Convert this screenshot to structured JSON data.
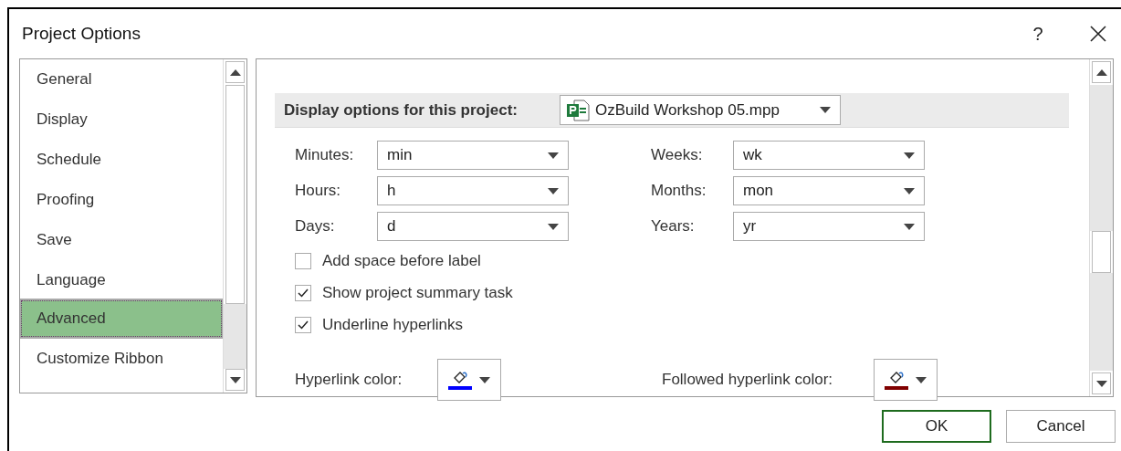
{
  "window": {
    "title": "Project Options",
    "help": "?"
  },
  "sidebar": {
    "items": [
      {
        "label": "General",
        "selected": false
      },
      {
        "label": "Display",
        "selected": false
      },
      {
        "label": "Schedule",
        "selected": false
      },
      {
        "label": "Proofing",
        "selected": false
      },
      {
        "label": "Save",
        "selected": false
      },
      {
        "label": "Language",
        "selected": false
      },
      {
        "label": "Advanced",
        "selected": true
      },
      {
        "label": "Customize Ribbon",
        "selected": false
      }
    ]
  },
  "section": {
    "title": "Display options for this project:",
    "project": "OzBuild Workshop 05.mpp"
  },
  "units_left": [
    {
      "label": "Minutes:",
      "value": "min"
    },
    {
      "label": "Hours:",
      "value": "h"
    },
    {
      "label": "Days:",
      "value": "d"
    }
  ],
  "units_right": [
    {
      "label": "Weeks:",
      "value": "wk"
    },
    {
      "label": "Months:",
      "value": "mon"
    },
    {
      "label": "Years:",
      "value": "yr"
    }
  ],
  "checkboxes": [
    {
      "label": "Add space before label",
      "checked": false
    },
    {
      "label": "Show project summary task",
      "checked": true
    },
    {
      "label": "Underline hyperlinks",
      "checked": true
    }
  ],
  "color_pickers": [
    {
      "label": "Hyperlink color:",
      "color": "#0000ff"
    },
    {
      "label": "Followed hyperlink color:",
      "color": "#800000"
    }
  ],
  "buttons": [
    {
      "label": "OK",
      "default": true
    },
    {
      "label": "Cancel",
      "default": false
    }
  ]
}
